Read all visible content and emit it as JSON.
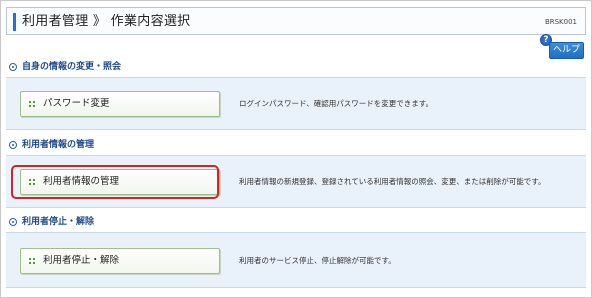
{
  "header": {
    "title": "利用者管理 》 作業内容選択",
    "screen_id": "BRSK001"
  },
  "help": {
    "icon_glyph": "?",
    "label": "ヘルプ"
  },
  "sections": [
    {
      "title": "自身の情報の変更・照会",
      "button_label": "パスワード変更",
      "description": "ログインパスワード、確認用パスワードを変更できます。"
    },
    {
      "title": "利用者情報の管理",
      "button_label": "利用者情報の管理",
      "description": "利用者情報の新規登録、登録されている利用者情報の照会、変更、または削除が可能です。"
    },
    {
      "title": "利用者停止・解除",
      "button_label": "利用者停止・解除",
      "description": "利用者のサービス停止、停止解除が可能です。"
    }
  ],
  "colors": {
    "title_accent": "#2b6fd0",
    "section_title": "#1f4b8a",
    "panel_background": "#e9f1fb",
    "highlight": "#d8231d",
    "help_button": "#1f6fc4"
  }
}
